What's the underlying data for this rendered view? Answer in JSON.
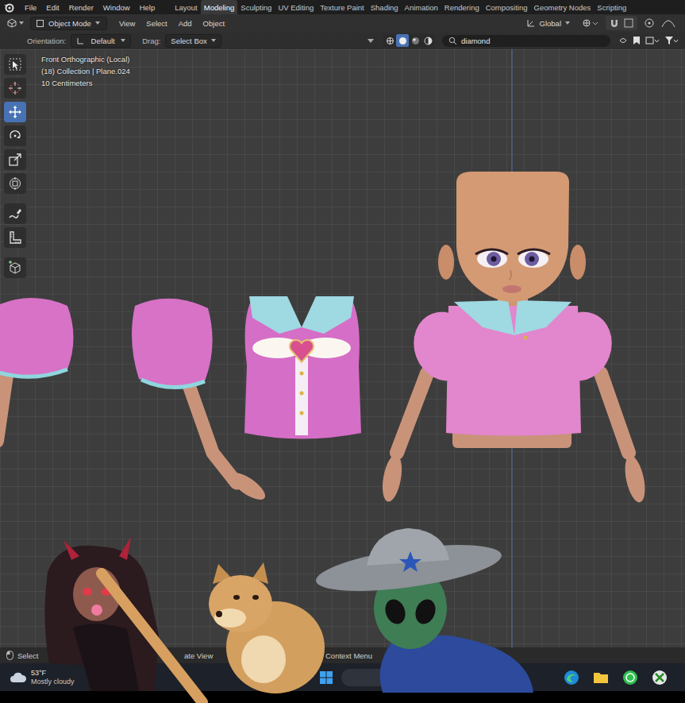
{
  "window": {
    "app": "Blender"
  },
  "top_menu": [
    "File",
    "Edit",
    "Render",
    "Window",
    "Help"
  ],
  "workspaces": [
    {
      "label": "Layout",
      "selected": false
    },
    {
      "label": "Modeling",
      "selected": true
    },
    {
      "label": "Sculpting",
      "selected": false
    },
    {
      "label": "UV Editing",
      "selected": false
    },
    {
      "label": "Texture Paint",
      "selected": false
    },
    {
      "label": "Shading",
      "selected": false
    },
    {
      "label": "Animation",
      "selected": false
    },
    {
      "label": "Rendering",
      "selected": false
    },
    {
      "label": "Compositing",
      "selected": false
    },
    {
      "label": "Geometry Nodes",
      "selected": false
    },
    {
      "label": "Scripting",
      "selected": false
    }
  ],
  "header": {
    "mode": "Object Mode",
    "menus": [
      "View",
      "Select",
      "Add",
      "Object"
    ],
    "orientation": "Global"
  },
  "tool_settings": {
    "orientation_label": "Orientation:",
    "orientation": "Default",
    "drag_label": "Drag:",
    "drag": "Select Box"
  },
  "shading": [
    {
      "mode": "wireframe",
      "selected": false
    },
    {
      "mode": "solid",
      "selected": true
    },
    {
      "mode": "material",
      "selected": false
    },
    {
      "mode": "rendered",
      "selected": false
    }
  ],
  "search": {
    "value": "diamond"
  },
  "viewport": {
    "info": [
      "Front Orthographic (Local)",
      "(18) Collection | Plane.024",
      "10 Centimeters"
    ]
  },
  "toolbar": [
    {
      "tool": "select",
      "selected": false
    },
    {
      "tool": "cursor",
      "selected": false
    },
    {
      "tool": "move",
      "selected": true
    },
    {
      "tool": "rotate",
      "selected": false
    },
    {
      "tool": "scale",
      "selected": false
    },
    {
      "tool": "transform",
      "selected": false
    },
    {
      "tool": "annotate",
      "selected": false
    },
    {
      "tool": "measure",
      "selected": false
    },
    {
      "tool": "add-cube",
      "selected": false
    }
  ],
  "status_bar": [
    "Select",
    "ate View",
    "Context Menu"
  ],
  "taskbar": {
    "temperature": "53°F",
    "weather": "Mostly cloudy"
  }
}
